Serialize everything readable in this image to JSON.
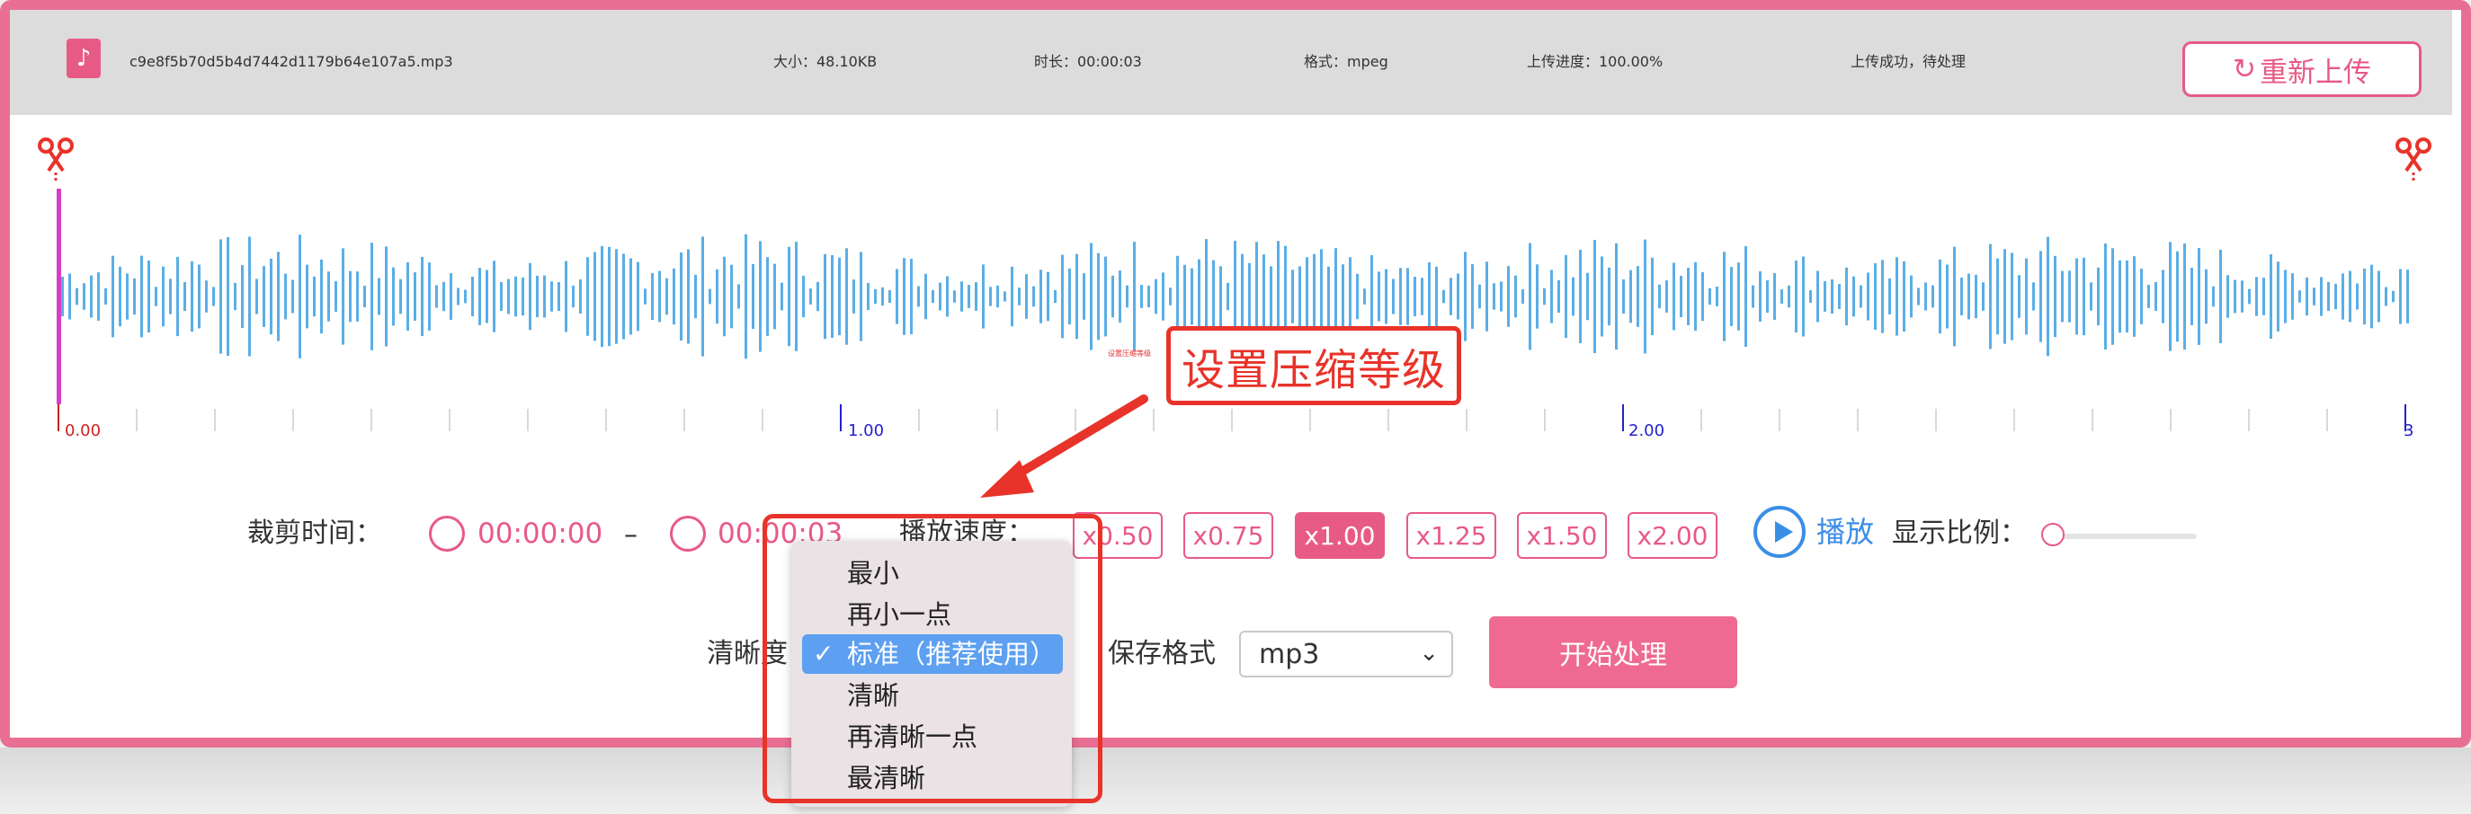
{
  "topbar": {
    "filename": "c9e8f5b70d5b4d7442d1179b64e107a5.mp3",
    "size": "大小：48.10KB",
    "duration": "时长：00:00:03",
    "format": "格式：mpeg",
    "progress": "上传进度：100.00%",
    "status": "上传成功，待处理",
    "reupload_label": "重新上传"
  },
  "timeline": {
    "ticks": [
      "0.00",
      "1.00",
      "2.00",
      "3"
    ],
    "tiny_label": "设置压缩等级"
  },
  "callout": "设置压缩等级",
  "controls": {
    "trim_label": "裁剪时间：",
    "start_time": "00:00:00",
    "dash": "–",
    "end_time": "00:00:03",
    "speed_label": "播放速度：",
    "speeds": [
      "x0.50",
      "x0.75",
      "x1.00",
      "x1.25",
      "x1.50",
      "x2.00"
    ],
    "active_speed": "x1.00",
    "play_label": "播放",
    "ratio_label": "显示比例：",
    "ratio_value": 0,
    "quality_label": "清晰度",
    "save_format_label": "保存格式",
    "save_format_value": "mp3",
    "start_label": "开始处理"
  },
  "quality_options": [
    "最小",
    "再小一点",
    "标准（推荐使用）",
    "清晰",
    "再清晰一点",
    "最清晰"
  ],
  "quality_selected": "标准（推荐使用）",
  "colors": {
    "accent": "#e85a86",
    "wave": "#5aaee6",
    "annotation": "#e8332a",
    "selected_option": "#5d9ff0"
  }
}
